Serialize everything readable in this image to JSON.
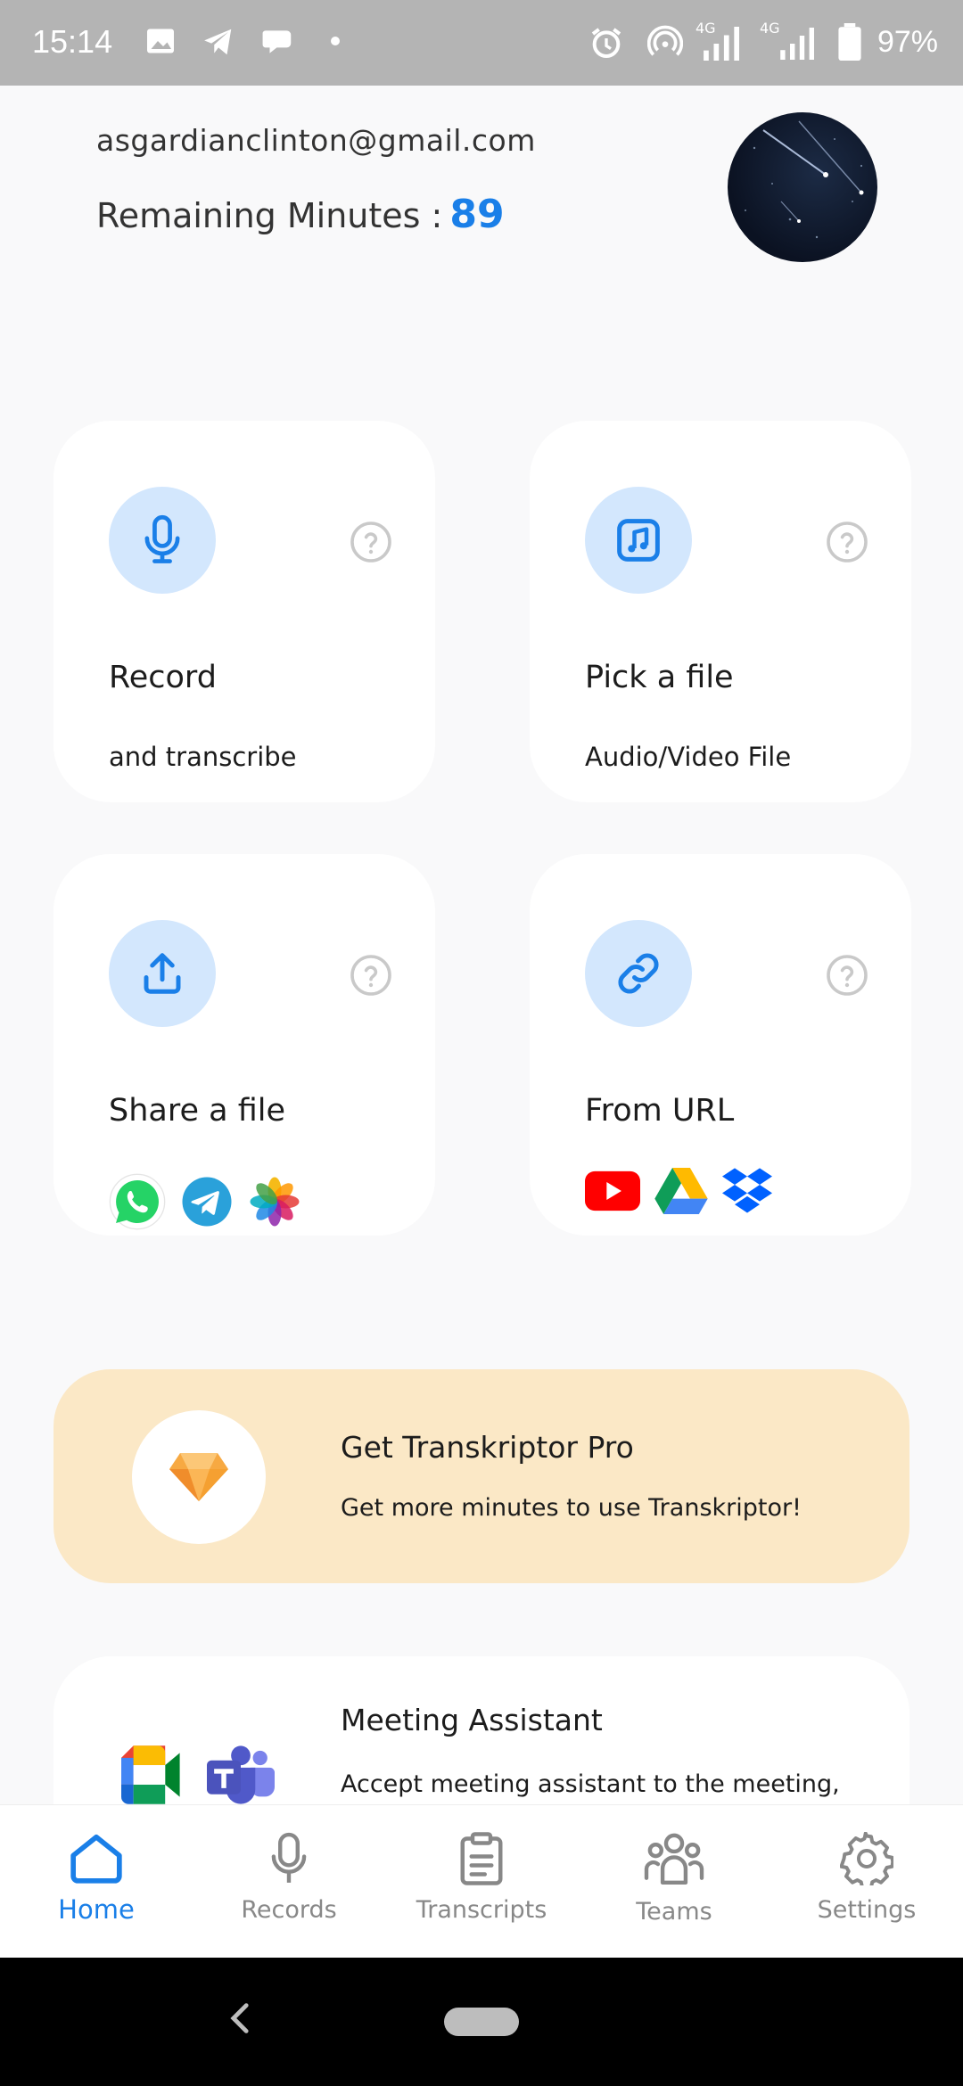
{
  "status_bar": {
    "time": "15:14",
    "network_a": "4G",
    "network_b": "4G",
    "battery": "97%",
    "icons": [
      "gallery-icon",
      "telegram-icon",
      "chat-bubble-icon",
      "dot-icon",
      "alarm-icon",
      "hotspot-icon",
      "signal-icon",
      "signal-icon",
      "battery-icon"
    ]
  },
  "header": {
    "email": "asgardianclinton@gmail.com",
    "remaining_label": "Remaining Minutes :",
    "remaining_value": "89"
  },
  "cards": {
    "record": {
      "title": "Record",
      "subtitle": "and transcribe",
      "icon": "microphone-icon"
    },
    "pick": {
      "title": "Pick a file",
      "subtitle": "Audio/Video File",
      "icon": "music-file-icon"
    },
    "share": {
      "title": "Share a file",
      "icon": "upload-icon",
      "apps": [
        "whatsapp-icon",
        "telegram-icon",
        "photos-icon"
      ]
    },
    "url": {
      "title": "From URL",
      "icon": "link-icon",
      "apps": [
        "youtube-icon",
        "google-drive-icon",
        "dropbox-icon"
      ]
    }
  },
  "pro_banner": {
    "title": "Get Transkriptor Pro",
    "subtitle": "Get more minutes to use Transkriptor!",
    "icon": "diamond-icon"
  },
  "meeting": {
    "title": "Meeting Assistant",
    "subtitle": "Accept meeting assistant to the meeting,",
    "apps": [
      "google-meet-icon",
      "microsoft-teams-icon"
    ]
  },
  "bottom_nav": {
    "items": [
      {
        "label": "Home",
        "icon": "home-icon",
        "active": true
      },
      {
        "label": "Records",
        "icon": "microphone-icon",
        "active": false
      },
      {
        "label": "Transcripts",
        "icon": "clipboard-icon",
        "active": false
      },
      {
        "label": "Teams",
        "icon": "team-icon",
        "active": false
      },
      {
        "label": "Settings",
        "icon": "gear-icon",
        "active": false
      }
    ]
  },
  "colors": {
    "accent": "#1a7fe8",
    "icon_circle": "#d3e7fd",
    "pro_banner": "#fbe8c6"
  }
}
